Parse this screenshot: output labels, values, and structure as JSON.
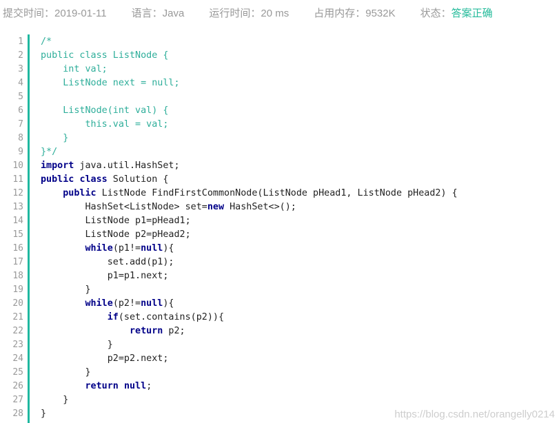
{
  "submission": {
    "submit_time_label": "提交时间：",
    "submit_time_value": "2019-01-11",
    "language_label": "语言：",
    "language_value": "Java",
    "runtime_label": "运行时间：",
    "runtime_value": "20 ms",
    "memory_label": "占用内存：",
    "memory_value": "9532K",
    "status_label": "状态：",
    "status_value": "答案正确"
  },
  "colors": {
    "status": "#25bb9b",
    "gutter_border": "#1fb8a0",
    "comment": "#2eae9a",
    "keyword": "#000088",
    "meta_text": "#999999"
  },
  "code": {
    "line_numbers": [
      "1",
      "2",
      "3",
      "4",
      "5",
      "6",
      "7",
      "8",
      "9",
      "10",
      "11",
      "12",
      "13",
      "14",
      "15",
      "16",
      "17",
      "18",
      "19",
      "20",
      "21",
      "22",
      "23",
      "24",
      "25",
      "26",
      "27",
      "28"
    ],
    "lines": [
      [
        {
          "t": "/*",
          "c": "comment"
        }
      ],
      [
        {
          "t": "public class ListNode {",
          "c": "comment"
        }
      ],
      [
        {
          "t": "    int val;",
          "c": "comment"
        }
      ],
      [
        {
          "t": "    ListNode next = null;",
          "c": "comment"
        }
      ],
      [
        {
          "t": "",
          "c": "comment"
        }
      ],
      [
        {
          "t": "    ListNode(int val) {",
          "c": "comment"
        }
      ],
      [
        {
          "t": "        this.val = val;",
          "c": "comment"
        }
      ],
      [
        {
          "t": "    }",
          "c": "comment"
        }
      ],
      [
        {
          "t": "}*/",
          "c": "comment"
        }
      ],
      [
        {
          "t": "import",
          "c": "keyword"
        },
        {
          "t": " java.util.HashSet;",
          "c": "text"
        }
      ],
      [
        {
          "t": "public",
          "c": "keyword"
        },
        {
          "t": " ",
          "c": "text"
        },
        {
          "t": "class",
          "c": "keyword"
        },
        {
          "t": " Solution {",
          "c": "text"
        }
      ],
      [
        {
          "t": "    ",
          "c": "text"
        },
        {
          "t": "public",
          "c": "keyword"
        },
        {
          "t": " ListNode FindFirstCommonNode(ListNode pHead1, ListNode pHead2) {",
          "c": "text"
        }
      ],
      [
        {
          "t": "        HashSet<ListNode> set=",
          "c": "text"
        },
        {
          "t": "new",
          "c": "keyword"
        },
        {
          "t": " HashSet<>();",
          "c": "text"
        }
      ],
      [
        {
          "t": "        ListNode p1=pHead1;",
          "c": "text"
        }
      ],
      [
        {
          "t": "        ListNode p2=pHead2;",
          "c": "text"
        }
      ],
      [
        {
          "t": "        ",
          "c": "text"
        },
        {
          "t": "while",
          "c": "keyword"
        },
        {
          "t": "(p1!=",
          "c": "text"
        },
        {
          "t": "null",
          "c": "keyword"
        },
        {
          "t": "){",
          "c": "text"
        }
      ],
      [
        {
          "t": "            set.add(p1);",
          "c": "text"
        }
      ],
      [
        {
          "t": "            p1=p1.next;",
          "c": "text"
        }
      ],
      [
        {
          "t": "        }",
          "c": "text"
        }
      ],
      [
        {
          "t": "        ",
          "c": "text"
        },
        {
          "t": "while",
          "c": "keyword"
        },
        {
          "t": "(p2!=",
          "c": "text"
        },
        {
          "t": "null",
          "c": "keyword"
        },
        {
          "t": "){",
          "c": "text"
        }
      ],
      [
        {
          "t": "            ",
          "c": "text"
        },
        {
          "t": "if",
          "c": "keyword"
        },
        {
          "t": "(set.contains(p2)){",
          "c": "text"
        }
      ],
      [
        {
          "t": "                ",
          "c": "text"
        },
        {
          "t": "return",
          "c": "keyword"
        },
        {
          "t": " p2;",
          "c": "text"
        }
      ],
      [
        {
          "t": "            }",
          "c": "text"
        }
      ],
      [
        {
          "t": "            p2=p2.next;",
          "c": "text"
        }
      ],
      [
        {
          "t": "        }",
          "c": "text"
        }
      ],
      [
        {
          "t": "        ",
          "c": "text"
        },
        {
          "t": "return",
          "c": "keyword"
        },
        {
          "t": " ",
          "c": "text"
        },
        {
          "t": "null",
          "c": "keyword"
        },
        {
          "t": ";",
          "c": "text"
        }
      ],
      [
        {
          "t": "    }",
          "c": "text"
        }
      ],
      [
        {
          "t": "}",
          "c": "text"
        }
      ]
    ]
  },
  "watermark": "https://blog.csdn.net/orangelly0214"
}
